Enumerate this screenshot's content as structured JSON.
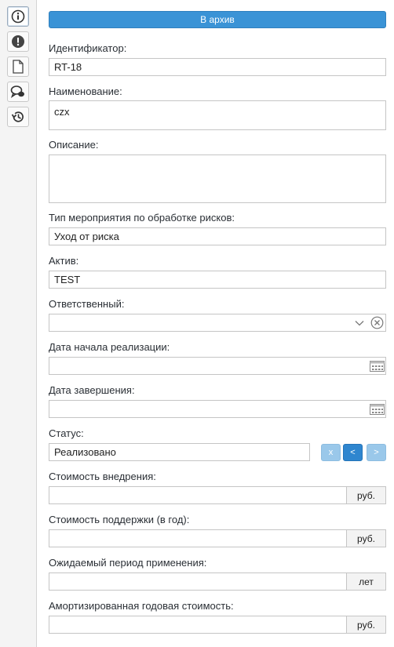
{
  "sidebar": {
    "items": [
      {
        "icon": "info-icon",
        "active": true
      },
      {
        "icon": "alert-icon",
        "active": false
      },
      {
        "icon": "document-icon",
        "active": false
      },
      {
        "icon": "comments-icon",
        "active": false
      },
      {
        "icon": "history-icon",
        "active": false
      }
    ]
  },
  "form": {
    "archive_label": "В архив",
    "identifier": {
      "label": "Идентификатор:",
      "value": "RT-18"
    },
    "name": {
      "label": "Наименование:",
      "value": "czx"
    },
    "description": {
      "label": "Описание:",
      "value": ""
    },
    "measure_type": {
      "label": "Тип мероприятия по обработке рисков:",
      "value": "Уход от риска"
    },
    "asset": {
      "label": "Актив:",
      "value": "TEST"
    },
    "responsible": {
      "label": "Ответственный:",
      "value": ""
    },
    "start_date": {
      "label": "Дата начала реализации:",
      "value": ""
    },
    "end_date": {
      "label": "Дата завершения:",
      "value": ""
    },
    "status": {
      "label": "Статус:",
      "value": "Реализовано",
      "btn_clear": "x",
      "btn_prev": "<",
      "btn_next": ">"
    },
    "impl_cost": {
      "label": "Стоимость внедрения:",
      "value": "",
      "unit": "руб."
    },
    "support_cost": {
      "label": "Стоимость поддержки (в год):",
      "value": "",
      "unit": "руб."
    },
    "period": {
      "label": "Ожидаемый период применения:",
      "value": "",
      "unit": "лет"
    },
    "amortized_cost": {
      "label": "Амортизированная годовая стоимость:",
      "value": "",
      "unit": "руб."
    }
  },
  "colors": {
    "accent": "#3a93d6",
    "accent_dark": "#2f86cf",
    "accent_light": "#9ac8ea"
  }
}
